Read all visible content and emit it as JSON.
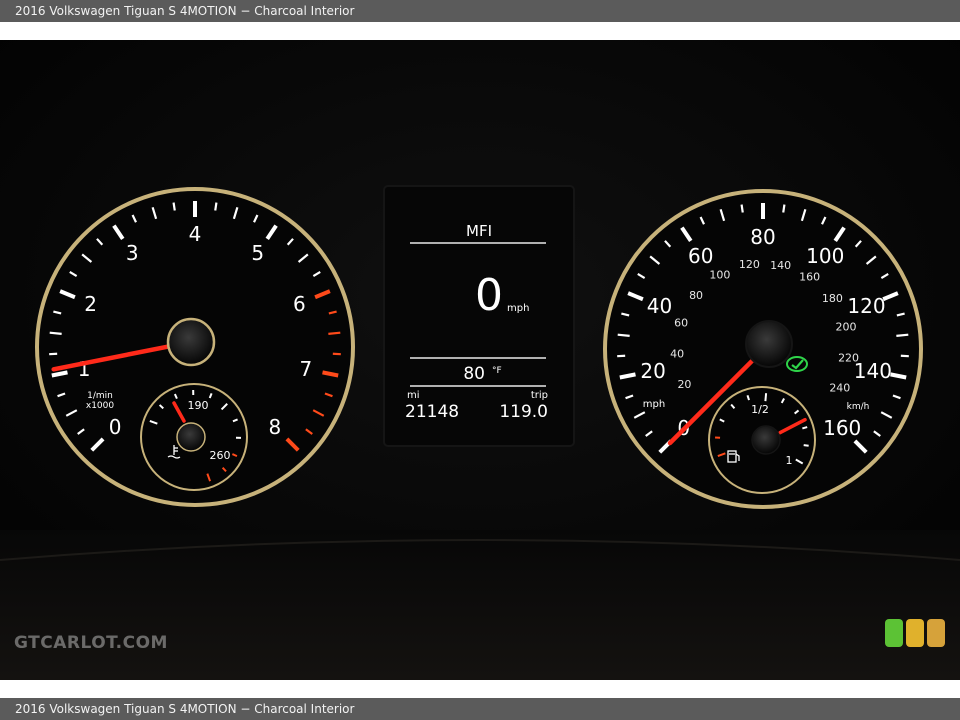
{
  "caption": {
    "top": "2016 Volkswagen Tiguan S 4MOTION − Charcoal Interior",
    "bottom": "2016 Volkswagen Tiguan S 4MOTION − Charcoal Interior"
  },
  "watermark": "GTCARLOT.COM",
  "colors": {
    "caption_bg": "#5b5b5b",
    "needle": "#ff2a1a",
    "dial_ring": "#c7b27a",
    "tick_red": "#ff4a1a",
    "indicator_green": "#2fd44a",
    "signal_green": "#5cc235",
    "signal_yellow": "#e0b12c",
    "signal_amber": "#d6a23a"
  },
  "tachometer": {
    "labels": [
      "0",
      "1",
      "2",
      "3",
      "4",
      "5",
      "6",
      "7",
      "8"
    ],
    "unit_top": "1/min",
    "unit_bottom": "x1000",
    "needle_value": 1.0,
    "coolant": {
      "label_low": "190",
      "label_high": "260",
      "icon": "coolant-temperature-icon"
    }
  },
  "display": {
    "mode": "MFI",
    "speed": "0",
    "speed_unit": "mph",
    "temperature": "80",
    "temperature_unit": "°F",
    "odometer_label": "mi",
    "odometer": "21148",
    "trip_label": "trip",
    "trip": "119.0"
  },
  "speedometer": {
    "mph_labels": [
      "0",
      "20",
      "40",
      "60",
      "80",
      "100",
      "120",
      "140",
      "160"
    ],
    "kmh_labels": [
      "20",
      "40",
      "60",
      "80",
      "100",
      "120",
      "140",
      "160",
      "180",
      "200",
      "220",
      "240"
    ],
    "unit_mph": "mph",
    "unit_kmh": "km/h",
    "needle_value": 0,
    "indicator_icon": "traction-control-icon",
    "fuel": {
      "label_half": "1/2",
      "label_full": "1",
      "icon": "fuel-pump-icon",
      "level": 0.75
    }
  }
}
